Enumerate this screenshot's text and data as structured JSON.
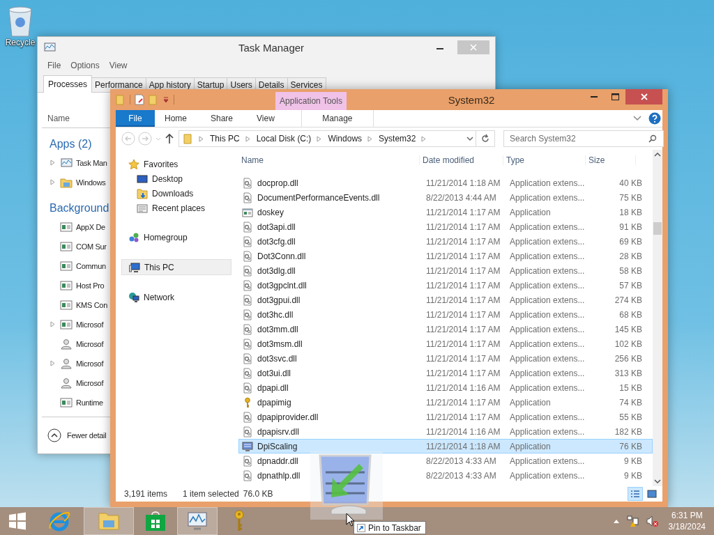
{
  "desktop_icons": [
    {
      "label": "Recycle"
    }
  ],
  "task_manager": {
    "title": "Task Manager",
    "menu": [
      "File",
      "Options",
      "View"
    ],
    "tabs": [
      {
        "label": "Processes",
        "selected": true
      },
      {
        "label": "Performance",
        "selected": false
      },
      {
        "label": "App history",
        "selected": false
      },
      {
        "label": "Startup",
        "selected": false
      },
      {
        "label": "Users",
        "selected": false
      },
      {
        "label": "Details",
        "selected": false
      },
      {
        "label": "Services",
        "selected": false
      }
    ],
    "column": "Name",
    "groups": [
      {
        "title": "Apps (2)",
        "items": [
          {
            "name": "Task Man",
            "kind": "chart",
            "expandable": true
          },
          {
            "name": "Windows",
            "kind": "folder",
            "expandable": true
          }
        ]
      },
      {
        "title": "Background",
        "items": [
          {
            "name": "AppX De",
            "kind": "service",
            "expandable": false
          },
          {
            "name": "COM Sur",
            "kind": "service",
            "expandable": false
          },
          {
            "name": "Commun",
            "kind": "service",
            "expandable": false
          },
          {
            "name": "Host Pro",
            "kind": "service",
            "expandable": false
          },
          {
            "name": "KMS Con",
            "kind": "service",
            "expandable": false
          },
          {
            "name": "Microsof",
            "kind": "service",
            "expandable": true
          },
          {
            "name": "Microsof",
            "kind": "user",
            "expandable": false
          },
          {
            "name": "Microsof",
            "kind": "user",
            "expandable": true
          },
          {
            "name": "Microsof",
            "kind": "user",
            "expandable": false
          },
          {
            "name": "Runtime",
            "kind": "service",
            "expandable": false
          }
        ]
      }
    ],
    "footer": "Fewer detail"
  },
  "explorer": {
    "title": "System32",
    "context_tab": "Application Tools",
    "ribbon_tabs": [
      {
        "label": "File",
        "kind": "file",
        "selected": true
      },
      {
        "label": "Home",
        "kind": "tab",
        "selected": false
      },
      {
        "label": "Share",
        "kind": "tab",
        "selected": false
      },
      {
        "label": "View",
        "kind": "tab",
        "selected": false
      },
      {
        "label": "Manage",
        "kind": "context",
        "selected": false
      }
    ],
    "breadcrumb": [
      "This PC",
      "Local Disk (C:)",
      "Windows",
      "System32"
    ],
    "search": {
      "placeholder": "Search System32"
    },
    "nav": [
      {
        "label": "Favorites",
        "kind": "star",
        "selected": false,
        "children": [
          {
            "label": "Desktop",
            "kind": "desktop",
            "selected": false
          },
          {
            "label": "Downloads",
            "kind": "downloads",
            "selected": false
          },
          {
            "label": "Recent places",
            "kind": "recent",
            "selected": false
          }
        ]
      },
      {
        "label": "Homegroup",
        "kind": "homegroup",
        "selected": false
      },
      {
        "label": "This PC",
        "kind": "pc",
        "selected": true
      },
      {
        "label": "Network",
        "kind": "network",
        "selected": false
      }
    ],
    "columns": [
      "Name",
      "Date modified",
      "Type",
      "Size"
    ],
    "rows": [
      {
        "name": "docprop.dll",
        "date": "11/21/2014 1:18 AM",
        "type": "Application extens...",
        "size": "40 KB",
        "kind": "dll",
        "selected": false
      },
      {
        "name": "DocumentPerformanceEvents.dll",
        "date": "8/22/2013 4:44 AM",
        "type": "Application extens...",
        "size": "75 KB",
        "kind": "dll",
        "selected": false
      },
      {
        "name": "doskey",
        "date": "11/21/2014 1:17 AM",
        "type": "Application",
        "size": "18 KB",
        "kind": "app",
        "selected": false
      },
      {
        "name": "dot3api.dll",
        "date": "11/21/2014 1:17 AM",
        "type": "Application extens...",
        "size": "91 KB",
        "kind": "dll",
        "selected": false
      },
      {
        "name": "dot3cfg.dll",
        "date": "11/21/2014 1:17 AM",
        "type": "Application extens...",
        "size": "69 KB",
        "kind": "dll",
        "selected": false
      },
      {
        "name": "Dot3Conn.dll",
        "date": "11/21/2014 1:17 AM",
        "type": "Application extens...",
        "size": "28 KB",
        "kind": "dll",
        "selected": false
      },
      {
        "name": "dot3dlg.dll",
        "date": "11/21/2014 1:17 AM",
        "type": "Application extens...",
        "size": "58 KB",
        "kind": "dll",
        "selected": false
      },
      {
        "name": "dot3gpclnt.dll",
        "date": "11/21/2014 1:17 AM",
        "type": "Application extens...",
        "size": "57 KB",
        "kind": "dll",
        "selected": false
      },
      {
        "name": "dot3gpui.dll",
        "date": "11/21/2014 1:17 AM",
        "type": "Application extens...",
        "size": "274 KB",
        "kind": "dll",
        "selected": false
      },
      {
        "name": "dot3hc.dll",
        "date": "11/21/2014 1:17 AM",
        "type": "Application extens...",
        "size": "68 KB",
        "kind": "dll",
        "selected": false
      },
      {
        "name": "dot3mm.dll",
        "date": "11/21/2014 1:17 AM",
        "type": "Application extens...",
        "size": "145 KB",
        "kind": "dll",
        "selected": false
      },
      {
        "name": "dot3msm.dll",
        "date": "11/21/2014 1:17 AM",
        "type": "Application extens...",
        "size": "102 KB",
        "kind": "dll",
        "selected": false
      },
      {
        "name": "dot3svc.dll",
        "date": "11/21/2014 1:17 AM",
        "type": "Application extens...",
        "size": "256 KB",
        "kind": "dll",
        "selected": false
      },
      {
        "name": "dot3ui.dll",
        "date": "11/21/2014 1:17 AM",
        "type": "Application extens...",
        "size": "313 KB",
        "kind": "dll",
        "selected": false
      },
      {
        "name": "dpapi.dll",
        "date": "11/21/2014 1:16 AM",
        "type": "Application extens...",
        "size": "15 KB",
        "kind": "dll",
        "selected": false
      },
      {
        "name": "dpapimig",
        "date": "11/21/2014 1:17 AM",
        "type": "Application",
        "size": "74 KB",
        "kind": "key",
        "selected": false
      },
      {
        "name": "dpapiprovider.dll",
        "date": "11/21/2014 1:17 AM",
        "type": "Application extens...",
        "size": "55 KB",
        "kind": "dll",
        "selected": false
      },
      {
        "name": "dpapisrv.dll",
        "date": "11/21/2014 1:16 AM",
        "type": "Application extens...",
        "size": "182 KB",
        "kind": "dll",
        "selected": false
      },
      {
        "name": "DpiScaling",
        "date": "11/21/2014 1:18 AM",
        "type": "Application",
        "size": "76 KB",
        "kind": "monitor",
        "selected": true
      },
      {
        "name": "dpnaddr.dll",
        "date": "8/22/2013 4:33 AM",
        "type": "Application extens...",
        "size": "9 KB",
        "kind": "dll",
        "selected": false
      },
      {
        "name": "dpnathlp.dll",
        "date": "8/22/2013 4:33 AM",
        "type": "Application extens...",
        "size": "9 KB",
        "kind": "dll",
        "selected": false
      }
    ],
    "status": {
      "count": "3,191 items",
      "selection": "1 item selected",
      "size": "76.0 KB"
    },
    "views": [
      {
        "kind": "details",
        "selected": true
      },
      {
        "kind": "large",
        "selected": false
      }
    ]
  },
  "taskbar": {
    "apps": [
      {
        "kind": "start",
        "active": false
      },
      {
        "kind": "ie",
        "active": false
      },
      {
        "kind": "explorer",
        "active": true
      },
      {
        "kind": "store",
        "active": false
      },
      {
        "kind": "taskmgr",
        "active": true
      },
      {
        "kind": "key",
        "active": false
      }
    ],
    "time": "6:31 PM",
    "date": "3/18/2024"
  },
  "tooltip": "Pin to Taskbar"
}
